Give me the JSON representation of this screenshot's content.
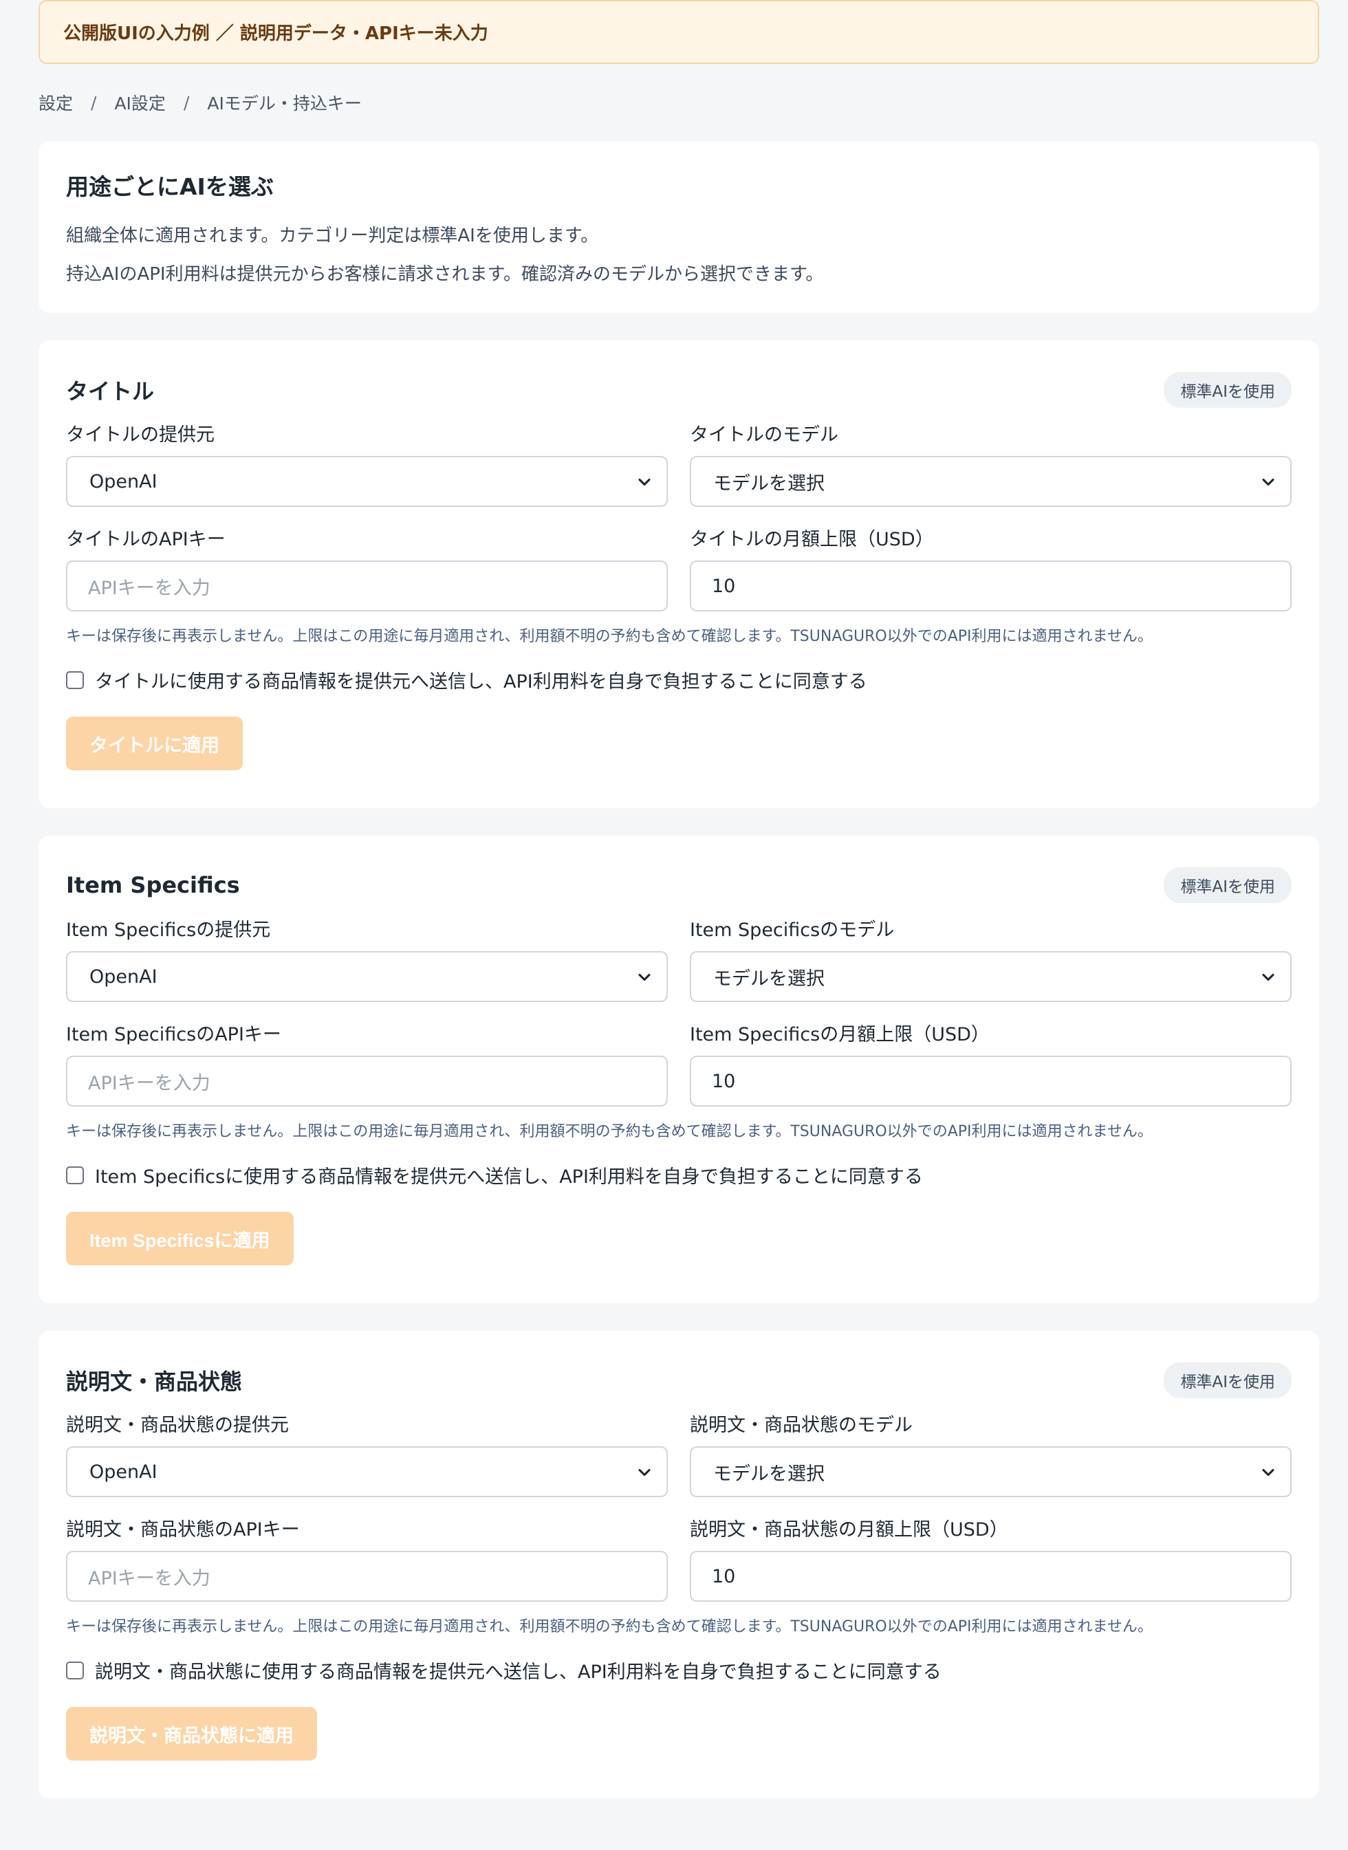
{
  "notice": "公開版UIの入力例 ／ 説明用データ・APIキー未入力",
  "breadcrumb": [
    "設定",
    "AI設定",
    "AIモデル・持込キー"
  ],
  "intro": {
    "title": "用途ごとにAIを選ぶ",
    "line1": "組織全体に適用されます。カテゴリー判定は標準AIを使用します。",
    "line2": "持込AIのAPI利用料は提供元からお客様に請求されます。確認済みのモデルから選択できます。"
  },
  "sections": [
    {
      "title": "タイトル",
      "badge": "標準AIを使用",
      "provider_label": "タイトルの提供元",
      "provider_value": "OpenAI",
      "model_label": "タイトルのモデル",
      "model_value": "モデルを選択",
      "apikey_label": "タイトルのAPIキー",
      "apikey_placeholder": "APIキーを入力",
      "limit_label": "タイトルの月額上限（USD）",
      "limit_value": "10",
      "hint": "キーは保存後に再表示しません。上限はこの用途に毎月適用され、利用額不明の予約も含めて確認します。TSUNAGURO以外でのAPI利用には適用されません。",
      "consent": "タイトルに使用する商品情報を提供元へ送信し、API利用料を自身で負担することに同意する",
      "apply": "タイトルに適用"
    },
    {
      "title": "Item Specifics",
      "badge": "標準AIを使用",
      "provider_label": "Item Specificsの提供元",
      "provider_value": "OpenAI",
      "model_label": "Item Specificsのモデル",
      "model_value": "モデルを選択",
      "apikey_label": "Item SpecificsのAPIキー",
      "apikey_placeholder": "APIキーを入力",
      "limit_label": "Item Specificsの月額上限（USD）",
      "limit_value": "10",
      "hint": "キーは保存後に再表示しません。上限はこの用途に毎月適用され、利用額不明の予約も含めて確認します。TSUNAGURO以外でのAPI利用には適用されません。",
      "consent": "Item Specificsに使用する商品情報を提供元へ送信し、API利用料を自身で負担することに同意する",
      "apply": "Item Specificsに適用"
    },
    {
      "title": "説明文・商品状態",
      "badge": "標準AIを使用",
      "provider_label": "説明文・商品状態の提供元",
      "provider_value": "OpenAI",
      "model_label": "説明文・商品状態のモデル",
      "model_value": "モデルを選択",
      "apikey_label": "説明文・商品状態のAPIキー",
      "apikey_placeholder": "APIキーを入力",
      "limit_label": "説明文・商品状態の月額上限（USD）",
      "limit_value": "10",
      "hint": "キーは保存後に再表示しません。上限はこの用途に毎月適用され、利用額不明の予約も含めて確認します。TSUNAGURO以外でのAPI利用には適用されません。",
      "consent": "説明文・商品状態に使用する商品情報を提供元へ送信し、API利用料を自身で負担することに同意する",
      "apply": "説明文・商品状態に適用"
    }
  ]
}
